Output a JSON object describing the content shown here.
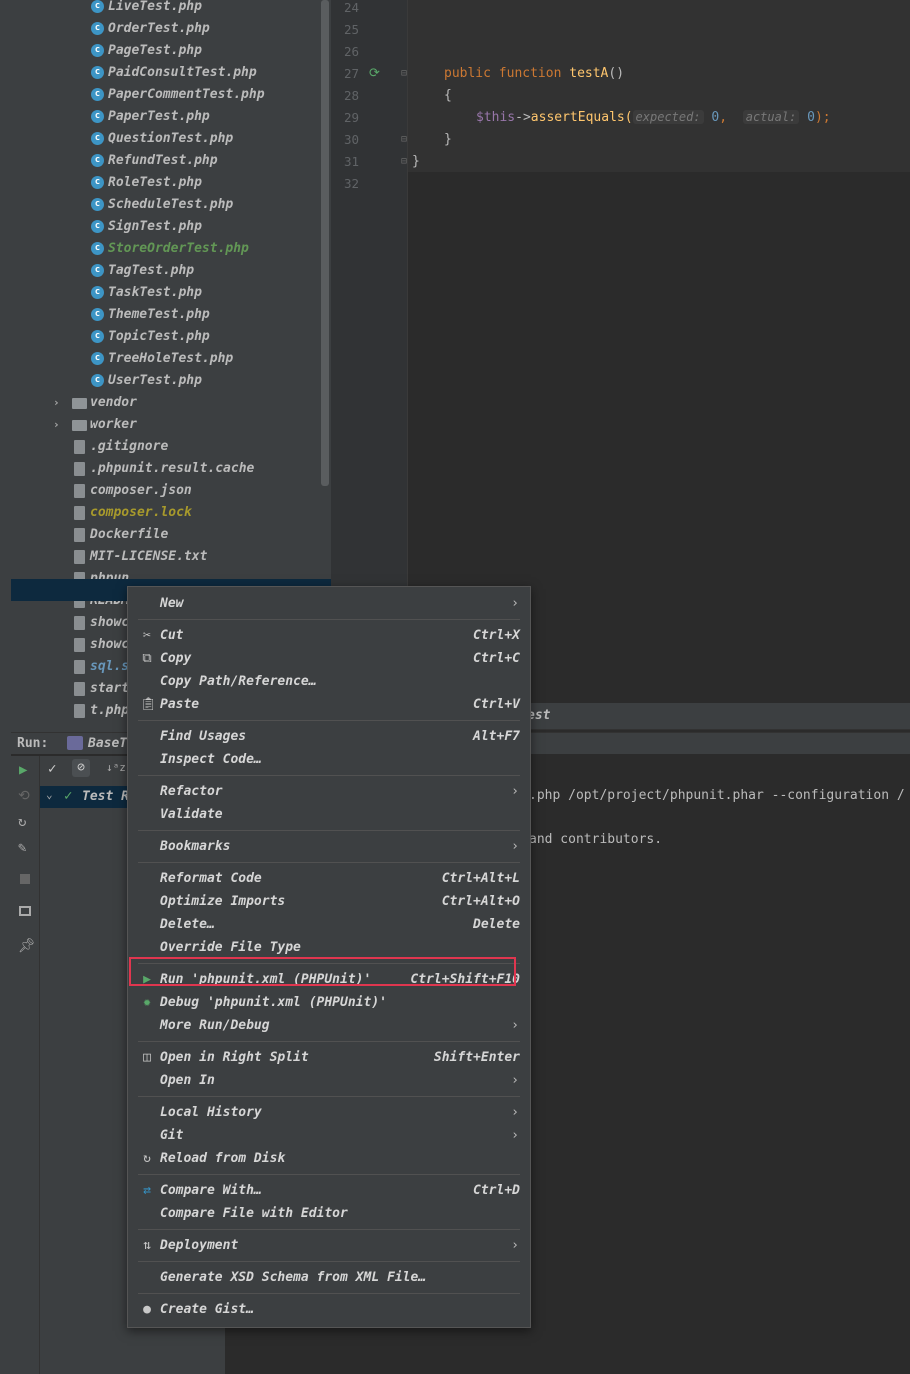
{
  "project_tree": {
    "files": [
      {
        "name": "LiveTest.php",
        "icon": "php-class-icon",
        "color": "#bbbbbb"
      },
      {
        "name": "OrderTest.php",
        "icon": "php-class-icon",
        "color": "#bbbbbb"
      },
      {
        "name": "PageTest.php",
        "icon": "php-class-icon",
        "color": "#bbbbbb"
      },
      {
        "name": "PaidConsultTest.php",
        "icon": "php-class-icon",
        "color": "#bbbbbb"
      },
      {
        "name": "PaperCommentTest.php",
        "icon": "php-class-icon",
        "color": "#bbbbbb"
      },
      {
        "name": "PaperTest.php",
        "icon": "php-class-icon",
        "color": "#bbbbbb"
      },
      {
        "name": "QuestionTest.php",
        "icon": "php-class-icon",
        "color": "#bbbbbb"
      },
      {
        "name": "RefundTest.php",
        "icon": "php-class-icon",
        "color": "#bbbbbb"
      },
      {
        "name": "RoleTest.php",
        "icon": "php-class-icon",
        "color": "#bbbbbb"
      },
      {
        "name": "ScheduleTest.php",
        "icon": "php-class-icon",
        "color": "#bbbbbb"
      },
      {
        "name": "SignTest.php",
        "icon": "php-class-icon",
        "color": "#bbbbbb"
      },
      {
        "name": "StoreOrderTest.php",
        "icon": "php-class-icon",
        "color": "#629755"
      },
      {
        "name": "TagTest.php",
        "icon": "php-class-icon",
        "color": "#bbbbbb"
      },
      {
        "name": "TaskTest.php",
        "icon": "php-class-icon",
        "color": "#bbbbbb"
      },
      {
        "name": "ThemeTest.php",
        "icon": "php-class-icon",
        "color": "#bbbbbb"
      },
      {
        "name": "TopicTest.php",
        "icon": "php-class-icon",
        "color": "#bbbbbb"
      },
      {
        "name": "TreeHoleTest.php",
        "icon": "php-class-icon",
        "color": "#bbbbbb"
      },
      {
        "name": "UserTest.php",
        "icon": "php-class-icon",
        "color": "#bbbbbb"
      }
    ],
    "folders": [
      "vendor",
      "worker"
    ],
    "root_files": [
      {
        "name": ".gitignore",
        "icon": "gitignore-file-icon",
        "color": "#bbbbbb"
      },
      {
        "name": ".phpunit.result.cache",
        "icon": "text-file-icon",
        "color": "#bbbbbb"
      },
      {
        "name": "composer.json",
        "icon": "composer-file-icon",
        "color": "#bbbbbb"
      },
      {
        "name": "composer.lock",
        "icon": "composer-file-icon",
        "color": "#a89a2c"
      },
      {
        "name": "Dockerfile",
        "icon": "docker-file-icon",
        "color": "#bbbbbb"
      },
      {
        "name": "MIT-LICENSE.txt",
        "icon": "text-file-icon",
        "color": "#bbbbbb"
      },
      {
        "name": "phpun",
        "icon": "xml-file-icon",
        "color": "#bbbbbb"
      },
      {
        "name": "READM",
        "icon": "markdown-file-icon",
        "color": "#bbbbbb"
      },
      {
        "name": "showc",
        "icon": "shell-file-icon",
        "color": "#bbbbbb"
      },
      {
        "name": "showc",
        "icon": "shell-file-icon",
        "color": "#bbbbbb"
      },
      {
        "name": "sql.s",
        "icon": "sql-file-icon",
        "color": "#6897bb"
      },
      {
        "name": "start",
        "icon": "php-file-icon",
        "color": "#bbbbbb"
      },
      {
        "name": "t.php",
        "icon": "php-file-icon",
        "color": "#bbbbbb"
      }
    ]
  },
  "editor": {
    "line_numbers": [
      "24",
      "25",
      "26",
      "27",
      "28",
      "29",
      "30",
      "31",
      "32"
    ],
    "code": {
      "public": "public",
      "function": "function",
      "fname": "testA",
      "parens": "()",
      "open_brace": "{",
      "this": "$this",
      "arrow": "->",
      "call": "assertEquals(",
      "hint_expected": "expected:",
      "val_expected": "0",
      "comma": ",",
      "hint_actual": "actual:",
      "val_actual": "0",
      "close_call": ");",
      "close_brace_inner": "}",
      "close_brace_outer": "}"
    }
  },
  "run_panel": {
    "label": "Run:",
    "tab": "BaseT",
    "editor_tab_fragment": "est",
    "test_root": "Test R",
    "console_line1": ".php /opt/project/phpunit.phar --configuration /",
    "console_line2": "and contributors."
  },
  "context_menu": {
    "items": [
      {
        "label": "New",
        "shortcut": "",
        "submenu": true,
        "icon": ""
      },
      {
        "label": "Cut",
        "shortcut": "Ctrl+X",
        "submenu": false,
        "icon": "scissors-icon"
      },
      {
        "label": "Copy",
        "shortcut": "Ctrl+C",
        "submenu": false,
        "icon": "copy-icon"
      },
      {
        "label": "Copy Path/Reference…",
        "shortcut": "",
        "submenu": false,
        "icon": ""
      },
      {
        "label": "Paste",
        "shortcut": "Ctrl+V",
        "submenu": false,
        "icon": "paste-icon"
      },
      {
        "label": "Find Usages",
        "shortcut": "Alt+F7",
        "submenu": false,
        "icon": ""
      },
      {
        "label": "Inspect Code…",
        "shortcut": "",
        "submenu": false,
        "icon": ""
      },
      {
        "label": "Refactor",
        "shortcut": "",
        "submenu": true,
        "icon": ""
      },
      {
        "label": "Validate",
        "shortcut": "",
        "submenu": false,
        "icon": ""
      },
      {
        "label": "Bookmarks",
        "shortcut": "",
        "submenu": true,
        "icon": ""
      },
      {
        "label": "Reformat Code",
        "shortcut": "Ctrl+Alt+L",
        "submenu": false,
        "icon": ""
      },
      {
        "label": "Optimize Imports",
        "shortcut": "Ctrl+Alt+O",
        "submenu": false,
        "icon": ""
      },
      {
        "label": "Delete…",
        "shortcut": "Delete",
        "submenu": false,
        "icon": ""
      },
      {
        "label": "Override File Type",
        "shortcut": "",
        "submenu": false,
        "icon": ""
      },
      {
        "label": "Run 'phpunit.xml (PHPUnit)'",
        "shortcut": "Ctrl+Shift+F10",
        "submenu": false,
        "icon": "run-icon"
      },
      {
        "label": "Debug 'phpunit.xml (PHPUnit)'",
        "shortcut": "",
        "submenu": false,
        "icon": "debug-icon"
      },
      {
        "label": "More Run/Debug",
        "shortcut": "",
        "submenu": true,
        "icon": ""
      },
      {
        "label": "Open in Right Split",
        "shortcut": "Shift+Enter",
        "submenu": false,
        "icon": "split-icon"
      },
      {
        "label": "Open In",
        "shortcut": "",
        "submenu": true,
        "icon": ""
      },
      {
        "label": "Local History",
        "shortcut": "",
        "submenu": true,
        "icon": ""
      },
      {
        "label": "Git",
        "shortcut": "",
        "submenu": true,
        "icon": ""
      },
      {
        "label": "Reload from Disk",
        "shortcut": "",
        "submenu": false,
        "icon": "reload-icon"
      },
      {
        "label": "Compare With…",
        "shortcut": "Ctrl+D",
        "submenu": false,
        "icon": "compare-icon"
      },
      {
        "label": "Compare File with Editor",
        "shortcut": "",
        "submenu": false,
        "icon": ""
      },
      {
        "label": "Deployment",
        "shortcut": "",
        "submenu": true,
        "icon": "deployment-icon"
      },
      {
        "label": "Generate XSD Schema from XML File…",
        "shortcut": "",
        "submenu": false,
        "icon": ""
      },
      {
        "label": "Create Gist…",
        "shortcut": "",
        "submenu": false,
        "icon": "github-icon"
      }
    ],
    "highlight_color": "#e0364f"
  }
}
